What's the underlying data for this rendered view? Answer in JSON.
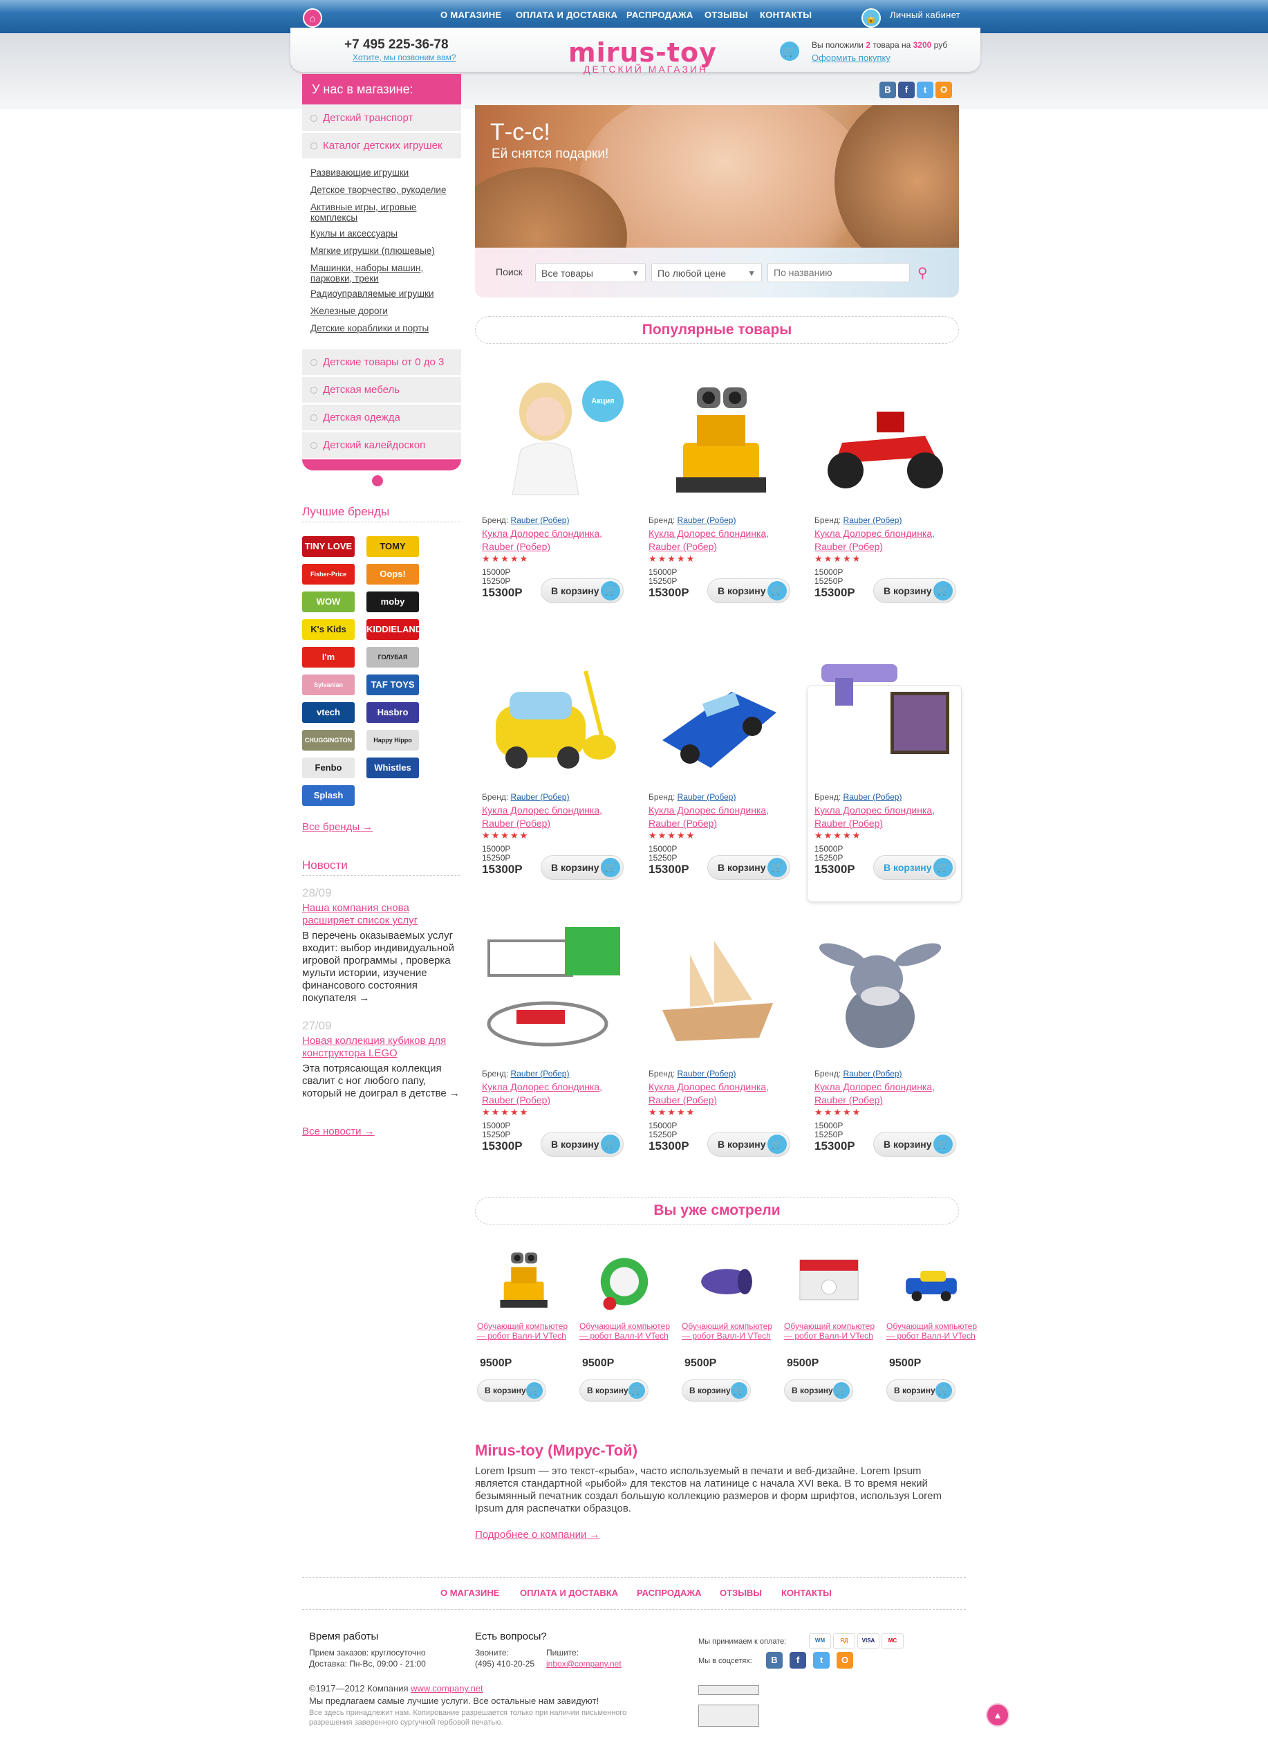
{
  "topnav": {
    "items": [
      "О МАГАЗИНЕ",
      "ОПЛАТА И ДОСТАВКА",
      "РАСПРОДАЖА",
      "ОТЗЫВЫ",
      "КОНТАКТЫ"
    ],
    "account_label": "Личный кабинет"
  },
  "header": {
    "phone": "+7 495 225-36-78",
    "callback_link": "Хотите, мы позвоним вам?",
    "logo": "mirus-toy",
    "logo_sub": "ДЕТСКИЙ МАГАЗИН",
    "cart_prefix": "Вы положили ",
    "cart_count": "2",
    "cart_middle": " товара на ",
    "cart_sum": "3200",
    "cart_suffix": " руб",
    "checkout_link": "Оформить покупку"
  },
  "sidebar": {
    "title": "У нас в магазине:",
    "categories_top": [
      "Детский транспорт",
      "Каталог детских игрушек"
    ],
    "subcategories": [
      "Развивающие игрушки",
      "Детское творчество, рукоделие",
      "Активные игры, игровые комплексы",
      "Куклы и аксессуары",
      "Мягкие игрушки (плюшевые)",
      "Машинки, наборы машин, парковки, треки",
      "Радиоуправляемые игрушки",
      "Железные дороги",
      "Детские кораблики и порты"
    ],
    "categories_bottom": [
      "Детские товары от 0 до 3",
      "Детская мебель",
      "Детская одежда",
      "Детский калейдоскоп"
    ]
  },
  "brands": {
    "title": "Лучшие бренды",
    "items": [
      {
        "name": "TINY LOVE",
        "color": "#c4121a"
      },
      {
        "name": "TOMY",
        "color": "#f2c200"
      },
      {
        "name": "Fisher-Price",
        "color": "#e32119"
      },
      {
        "name": "Oops!",
        "color": "#f08a1c"
      },
      {
        "name": "WOW",
        "color": "#7bb83a"
      },
      {
        "name": "moby",
        "color": "#1a1a1a"
      },
      {
        "name": "K's Kids",
        "color": "#f4d800"
      },
      {
        "name": "KIDDIELAND",
        "color": "#d7141a"
      },
      {
        "name": "I'm",
        "color": "#e2231a"
      },
      {
        "name": "ГОЛУБАЯ СТРЕЛА",
        "color": "#bdbdbd"
      },
      {
        "name": "Sylvanian Families",
        "color": "#e89cb2"
      },
      {
        "name": "TAF TOYS",
        "color": "#1f5fae"
      },
      {
        "name": "vtech",
        "color": "#0d4a8f"
      },
      {
        "name": "Hasbro",
        "color": "#3b3b9c"
      },
      {
        "name": "CHUGGINGTON",
        "color": "#8c8c6a"
      },
      {
        "name": "Happy Hippo",
        "color": "#e0e0e0"
      },
      {
        "name": "Fenbo",
        "color": "#e8e8e8"
      },
      {
        "name": "Whistles",
        "color": "#1d4f9e"
      },
      {
        "name": "Splash",
        "color": "#2f6cc9"
      }
    ],
    "all_link": "Все бренды →"
  },
  "news": {
    "title": "Новости",
    "items": [
      {
        "date": "28/09",
        "title": "Наша компания снова расширяет список услуг",
        "text": "В перечень оказываемых услуг входит: выбор индивидуальной игровой программы , проверка мульти истории, изучение финансового состояния покупателя →"
      },
      {
        "date": "27/09",
        "title": "Новая коллекция кубиков для конструктора LEGO",
        "text": "Эта потрясающая коллекция свалит с ног любого папу, который не доиграл в детстве →"
      }
    ],
    "all_link": "Все новости →"
  },
  "banner": {
    "title": "Т-с-с!",
    "subtitle": "Ей снятся подарки!"
  },
  "search": {
    "label": "Поиск",
    "category": "Все товары",
    "price": "По любой цене",
    "name_placeholder": "По названию"
  },
  "popular": {
    "title": "Популярные товары",
    "badge": "Акция",
    "brand_label": "Бренд:",
    "brand": "Rauber (Робер)",
    "product_title": "Кукла Долорес блондинка, Rauber (Робер)",
    "stars": "★★★★★",
    "old1": "15000Р",
    "old2": "15250Р",
    "price": "15300Р",
    "cart_label": "В корзину"
  },
  "viewed": {
    "title": "Вы уже смотрели",
    "product_title": "Обучающий компьютер — робот Валл-И VTech",
    "price": "9500Р",
    "cart_label": "В корзину"
  },
  "about": {
    "title": "Mirus-toy (Мирус-Той)",
    "text": "Lorem Ipsum — это текст-«рыба», часто используемый в печати и веб-дизайне. Lorem Ipsum является стандартной «рыбой» для текстов на латинице с начала XVI века. В то время некий безымянный печатник создал большую коллекцию размеров и форм шрифтов, используя Lorem Ipsum для распечатки образцов.",
    "more_link": "Подробнее о компании →"
  },
  "footer": {
    "nav": [
      "О МАГАЗИНЕ",
      "ОПЛАТА И ДОСТАВКА",
      "РАСПРОДАЖА",
      "ОТЗЫВЫ",
      "КОНТАКТЫ"
    ],
    "hours_title": "Время работы",
    "hours_line1": "Прием заказов: круглосуточно",
    "hours_line2": "Доставка: Пн-Вс, 09:00 - 21:00",
    "questions_title": "Есть вопросы?",
    "call_label": "Звоните:",
    "write_label": "Пишите:",
    "phone": "(495) 410-20-25",
    "email": "inbox@company.net",
    "payments_label": "Мы принимаем к оплате:",
    "social_label": "Мы в соцсетях:",
    "copyright_prefix": "©1917—2012 Компания ",
    "copyright_link": "www.company.net",
    "slogan": "Мы предлагаем самые лучшие услуги. Все остальные нам завидуют!",
    "disclaimer": "Все здесь принадлежит нам. Копирование разрешается только при наличии письменного разрешения заверенного сургучной гербовой печатью."
  }
}
